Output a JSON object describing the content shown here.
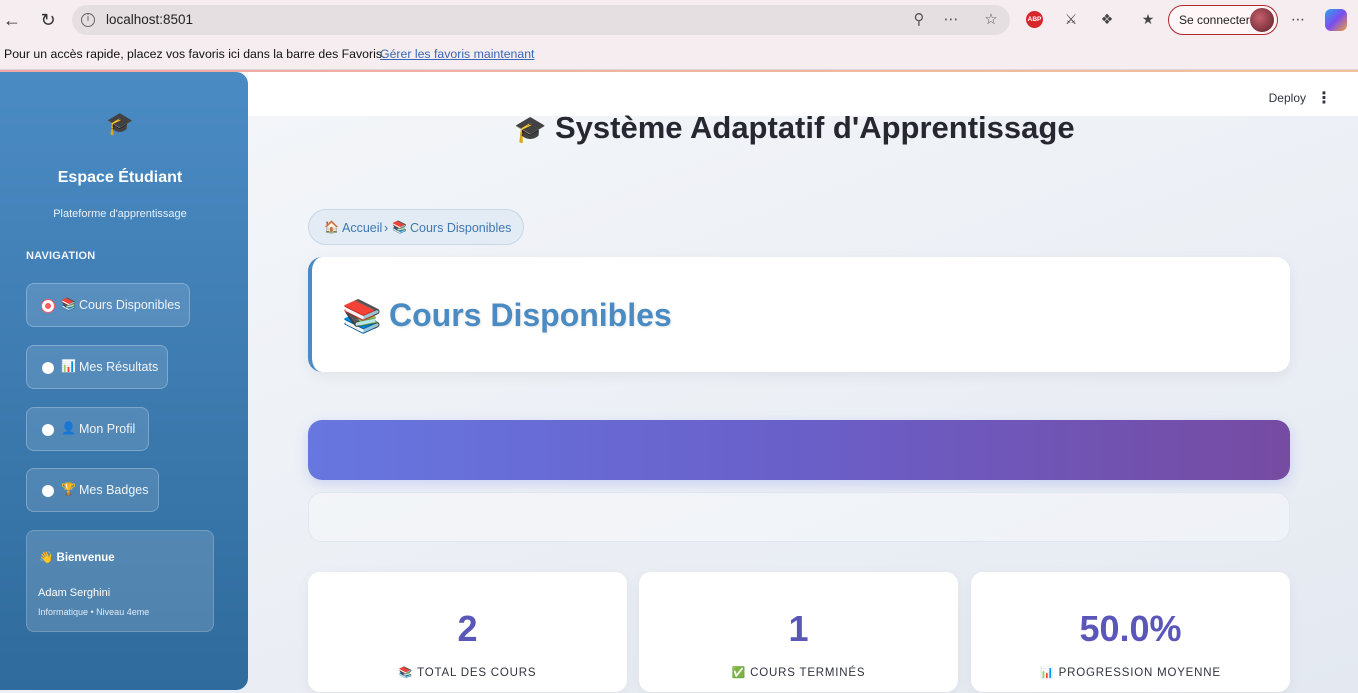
{
  "browser": {
    "url": "localhost:8501",
    "sign_in": "Se connecter",
    "favorites_text": "Pour un accès rapide, placez vos favoris ici dans la barre des Favoris.",
    "favorites_link": "Gérer les favoris maintenant"
  },
  "header": {
    "deploy": "Deploy",
    "menu": "⋮"
  },
  "sidebar": {
    "logo": "🎓",
    "title": "Espace Étudiant",
    "subtitle": "Plateforme d'apprentissage",
    "nav_heading": "NAVIGATION",
    "items": [
      {
        "icon": "📚",
        "label": "Cours Disponibles",
        "selected": true
      },
      {
        "icon": "📊",
        "label": "Mes Résultats",
        "selected": false
      },
      {
        "icon": "👤",
        "label": "Mon Profil",
        "selected": false
      },
      {
        "icon": "🏆",
        "label": "Mes Badges",
        "selected": false
      }
    ],
    "welcome": {
      "title": "👋 Bienvenue",
      "name": "Adam Serghini",
      "info": "Informatique • Niveau 4eme"
    }
  },
  "main": {
    "title_icon": "🎓",
    "title": "Système Adaptatif d'Apprentissage",
    "breadcrumb": {
      "home_icon": "🏠",
      "home": "Accueil",
      "sep": "›",
      "page_icon": "📚",
      "page": "Cours Disponibles"
    },
    "hero_icon": "📚",
    "hero_title": "Cours Disponibles",
    "stats": [
      {
        "value": "2",
        "icon": "📚",
        "label": "TOTAL DES COURS"
      },
      {
        "value": "1",
        "icon": "✅",
        "label": "COURS TERMINÉS"
      },
      {
        "value": "50.0%",
        "icon": "📊",
        "label": "PROGRESSION MOYENNE"
      }
    ]
  }
}
